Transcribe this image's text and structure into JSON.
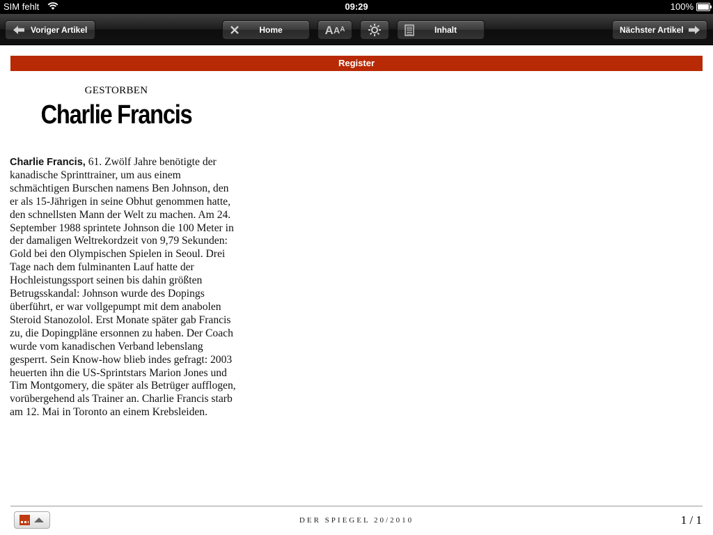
{
  "status_bar": {
    "carrier": "SIM fehlt",
    "time": "09:29",
    "battery": "100%"
  },
  "toolbar": {
    "prev_label": "Voriger Artikel",
    "home_label": "Home",
    "font_label": "AAA",
    "toc_label": "Inhalt",
    "next_label": "Nächster Artikel"
  },
  "article": {
    "ressort": "Register",
    "kicker": "GESTORBEN",
    "headline": "Charlie Francis",
    "lead": "Charlie Francis,",
    "body": " 61. Zwölf Jahre benötigte der kanadische Sprinttrainer, um aus einem schmächtigen Burschen namens Ben Johnson, den er als 15-Jährigen in seine Obhut genommen hatte, den schnellsten Mann der Welt zu machen. Am 24. September 1988 sprintete Johnson die 100 Meter in der damaligen Weltrekordzeit von 9,79 Sekunden: Gold bei den Olympischen Spielen in Seoul. Drei Tage nach dem fulminanten Lauf hatte der Hochleistungssport seinen bis dahin größten Betrugsskandal: Johnson wurde des Dopings überführt, er war vollgepumpt mit dem anabolen Steroid Stanozolol. Erst Monate später gab Francis zu, die Dopingpläne ersonnen zu haben. Der Coach wurde vom kanadischen Verband lebenslang gesperrt. Sein Know-how blieb indes gefragt: 2003 heuerten ihn die US-Sprintstars Marion Jones und Tim Montgomery, die später als Betrüger aufflogen, vorübergehend als Trainer an. Charlie Francis starb am 12. Mai in Toronto an einem Krebsleiden."
  },
  "footer": {
    "magazine": "DER SPIEGEL 20/2010",
    "page": "1 / 1"
  },
  "colors": {
    "ressort_bar": "#b82a05",
    "toolbar": "#1c1c1c"
  },
  "icons": [
    "wifi-icon",
    "battery-icon",
    "arrow-left-icon",
    "close-icon",
    "font-size-icon",
    "brightness-icon",
    "table-of-contents-icon",
    "arrow-right-icon",
    "page-thumbnail-icon",
    "chevron-up-icon"
  ]
}
